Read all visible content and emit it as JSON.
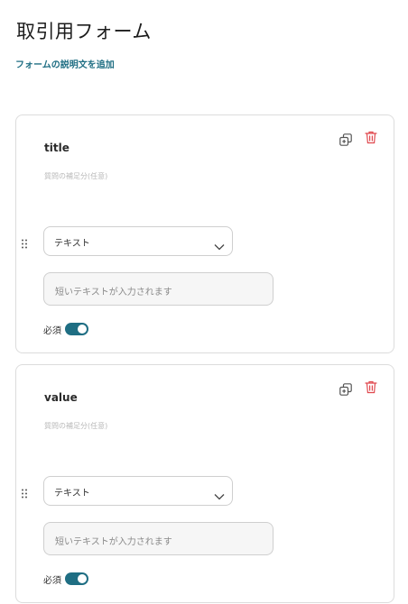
{
  "form": {
    "title": "取引用フォーム",
    "add_description_link": "フォームの説明文を追加"
  },
  "questions": [
    {
      "title": "title",
      "help_placeholder": "質問の補足分(任意)",
      "type": "テキスト",
      "answer_placeholder": "短いテキストが入力されます",
      "required_label": "必須",
      "required": true
    },
    {
      "title": "value",
      "help_placeholder": "質問の補足分(任意)",
      "type": "テキスト",
      "answer_placeholder": "短いテキストが入力されます",
      "required_label": "必須",
      "required": true
    }
  ],
  "icons": {
    "copy": "copy-icon",
    "delete": "trash-icon",
    "drag": "drag-handle-icon",
    "dropdown": "chevron-down-icon"
  },
  "colors": {
    "accent": "#1f6e83",
    "delete": "#e0484e",
    "border": "#dcdcdc"
  }
}
